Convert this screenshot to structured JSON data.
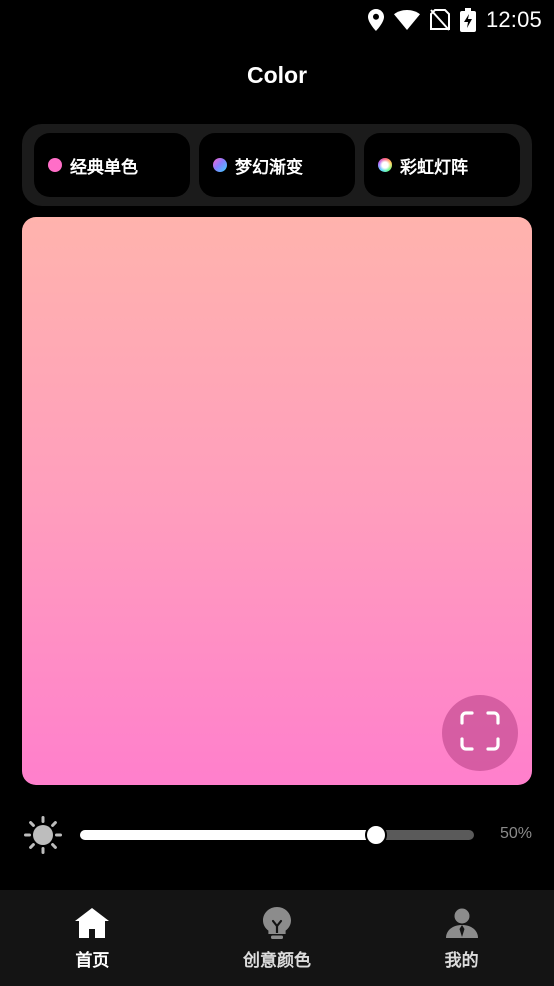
{
  "status_bar": {
    "time": "12:05",
    "icons": [
      "location-icon",
      "wifi-icon",
      "no-sim-icon",
      "battery-charging-icon"
    ]
  },
  "header": {
    "title": "Color"
  },
  "mode_tabs": [
    {
      "label": "经典单色",
      "icon": "solid-color-dot"
    },
    {
      "label": "梦幻渐变",
      "icon": "gradient-dot"
    },
    {
      "label": "彩虹灯阵",
      "icon": "rainbow-dot"
    }
  ],
  "preview": {
    "gradient_top": "#ffb3ad",
    "gradient_bottom": "#ff7fcc",
    "fullscreen_icon": "fullscreen-icon"
  },
  "brightness": {
    "icon": "sun-icon",
    "level": 0.75,
    "value_label": "50%"
  },
  "bottom_nav": [
    {
      "label": "首页",
      "icon": "home-icon",
      "active": true
    },
    {
      "label": "创意颜色",
      "icon": "lightbulb-icon",
      "active": false
    },
    {
      "label": "我的",
      "icon": "user-icon",
      "active": false
    }
  ],
  "colors": {
    "background": "#000000",
    "tab_container": "#1b1b1b",
    "nav_background": "#141414",
    "accent_pink": "#ff6ec8"
  }
}
